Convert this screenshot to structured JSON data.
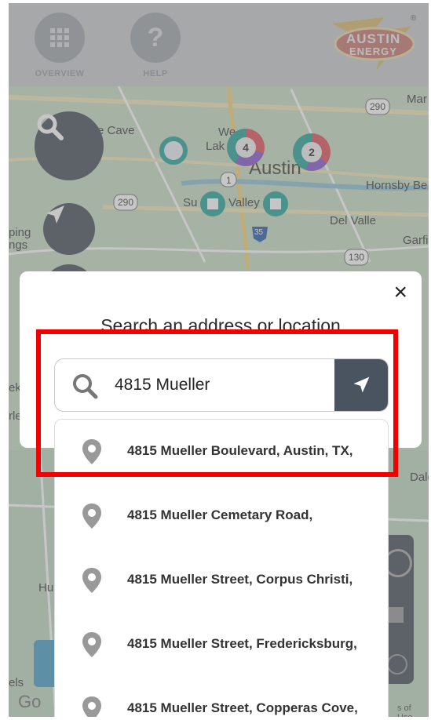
{
  "header": {
    "overview_label": "OVERVIEW",
    "help_label": "HELP",
    "logo_line1": "AUSTIN",
    "logo_line2": "ENERGY",
    "logo_reg": "®"
  },
  "map": {
    "labels": {
      "cave": "e Cave",
      "lake": "Lak",
      "we": "We",
      "austin": "Austin",
      "hornsby": "Hornsby Be",
      "sunset_valley": "Valley",
      "su": "Su",
      "del_valle": "Del Valle",
      "garfield": "Garfi",
      "ping": "ping",
      "ngs": "ngs",
      "hu": "Hu",
      "dale": "Dale",
      "ek": "ek",
      "rle": "rle",
      "els": "els",
      "mar": "Mar"
    },
    "shields": [
      "290",
      "290",
      "1",
      "35",
      "130"
    ],
    "clusters": [
      {
        "count": "4"
      },
      {
        "count": "2"
      }
    ],
    "attribution": "s of Use",
    "google_partial": "Go"
  },
  "modal": {
    "title": "Search an address or location",
    "close_label": "×"
  },
  "search": {
    "value": "4815 Mueller",
    "placeholder": ""
  },
  "results": [
    {
      "label": "4815 Mueller Boulevard, Austin, TX,"
    },
    {
      "label": "4815 Mueller Cemetary Road,"
    },
    {
      "label": "4815 Mueller Street, Corpus Christi,"
    },
    {
      "label": "4815 Mueller Street, Fredericksburg,"
    },
    {
      "label": "4815 Mueller Street, Copperas Cove,"
    }
  ],
  "colors": {
    "button_dark": "#4a5360",
    "highlight": "#f20000",
    "cluster_red": "#e0555e",
    "cluster_purple": "#8a5bd3",
    "cluster_teal": "#2aa69a"
  }
}
